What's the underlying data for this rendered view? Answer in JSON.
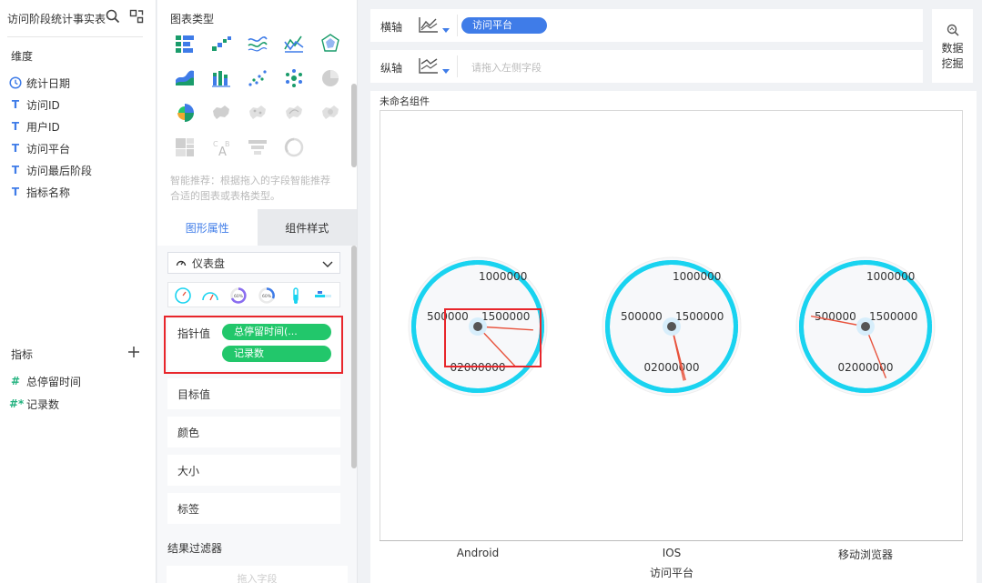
{
  "left": {
    "datasource": "访问阶段统计事实表",
    "dimension_title": "维度",
    "dimensions": [
      {
        "icon": "clock-icon",
        "label": "统计日期"
      },
      {
        "icon": "T",
        "label": "访问ID"
      },
      {
        "icon": "T",
        "label": "用户ID"
      },
      {
        "icon": "T",
        "label": "访问平台"
      },
      {
        "icon": "T",
        "label": "访问最后阶段"
      },
      {
        "icon": "T",
        "label": "指标名称"
      }
    ],
    "measure_title": "指标",
    "measures": [
      {
        "icon": "#",
        "label": "总停留时间"
      },
      {
        "icon": "#*",
        "label": "记录数"
      }
    ]
  },
  "mid": {
    "chart_type_title": "图表类型",
    "hint": "智能推荐：根据拖入的字段智能推荐合适的图表或表格类型。",
    "tabs": [
      "图形属性",
      "组件样式"
    ],
    "chart_kind": "仪表盘",
    "pointer_label": "指针值",
    "pointer_fields": [
      "总停留时间(...",
      "记录数"
    ],
    "props": [
      "目标值",
      "颜色",
      "大小",
      "标签"
    ],
    "filter_title": "结果过滤器",
    "drop_placeholder": "拖入字段"
  },
  "axes": {
    "x_label": "横轴",
    "x_field": "访问平台",
    "y_label": "纵轴",
    "y_placeholder": "请拖入左侧字段"
  },
  "mining": {
    "line1": "数据",
    "line2": "挖掘"
  },
  "canvas": {
    "component_title": "未命名组件",
    "x_axis_title": "访问平台"
  },
  "colors": {
    "accent": "#3f7ce8",
    "field_green": "#22c76b",
    "gauge_ring": "#19d3f0",
    "needle": "#e8533d",
    "highlight": "#e8262b"
  },
  "chart_data": {
    "type": "gauge",
    "categories": [
      "Android",
      "IOS",
      "移动浏览器"
    ],
    "range": [
      0,
      2000000
    ],
    "tick_labels": [
      "0",
      "500000",
      "1000000",
      "1500000",
      "2000000"
    ],
    "pointer_fields": [
      "总停留时间",
      "记录数"
    ],
    "xlabel": "访问平台",
    "series": [
      {
        "values": [
          1520000,
          1760000
        ]
      },
      {
        "values": [
          1930000,
          1920000
        ]
      },
      {
        "values": [
          560000,
          1880000
        ]
      }
    ]
  }
}
